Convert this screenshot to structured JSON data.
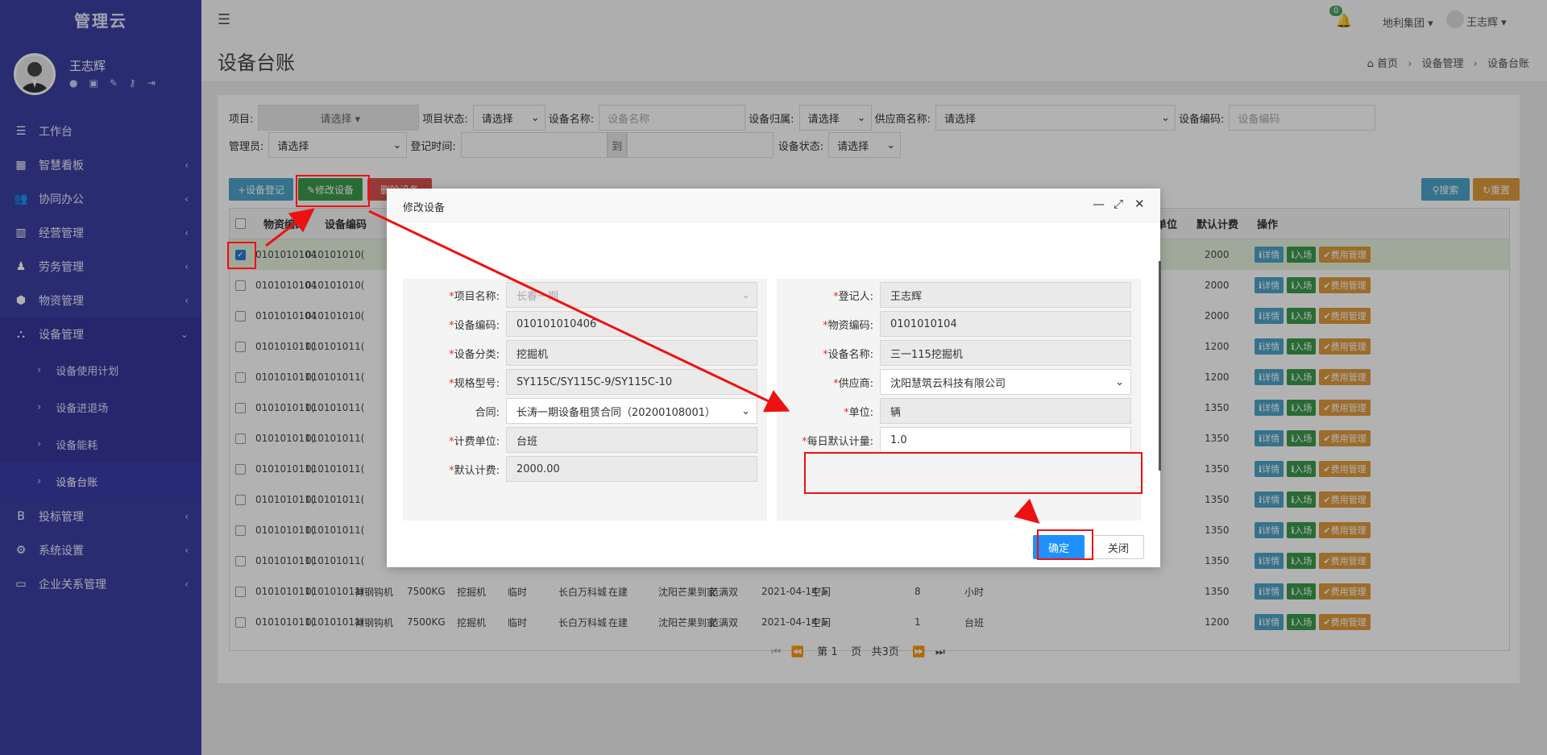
{
  "brand": "管理云",
  "user": {
    "name": "王志辉"
  },
  "sidebar": {
    "items": [
      {
        "label": "工作台",
        "icon": "dashboard-icon",
        "glyph": "☰",
        "chev": ""
      },
      {
        "label": "智慧看板",
        "icon": "board-icon",
        "glyph": "▦",
        "chev": "‹"
      },
      {
        "label": "协同办公",
        "icon": "users-icon",
        "glyph": "👥",
        "chev": "‹"
      },
      {
        "label": "经营管理",
        "icon": "bar-chart-icon",
        "glyph": "▥",
        "chev": "‹"
      },
      {
        "label": "劳务管理",
        "icon": "worker-icon",
        "glyph": "♟",
        "chev": "‹"
      },
      {
        "label": "物资管理",
        "icon": "cube-icon",
        "glyph": "⬢",
        "chev": "‹"
      },
      {
        "label": "设备管理",
        "icon": "cubes-icon",
        "glyph": "⛬",
        "chev": "⌄"
      }
    ],
    "sub_items": [
      "设备使用计划",
      "设备进退场",
      "设备能耗",
      "设备台账"
    ],
    "items_after": [
      {
        "label": "投标管理",
        "icon": "bold-b-icon",
        "glyph": "B",
        "chev": "‹"
      },
      {
        "label": "系统设置",
        "icon": "gear-icon",
        "glyph": "⚙",
        "chev": "‹"
      },
      {
        "label": "企业关系管理",
        "icon": "monitor-icon",
        "glyph": "▭",
        "chev": "‹"
      }
    ]
  },
  "topbar": {
    "notifications": "0",
    "company": "地利集团 ▾",
    "user": "王志辉 ▾"
  },
  "page": {
    "title": "设备台账",
    "breadcrumb": [
      "首页",
      "设备管理",
      "设备台账"
    ]
  },
  "filters": {
    "project_label": "项目:",
    "project_value": "请选择 ▾",
    "project_status_label": "项目状态:",
    "project_status_value": "请选择",
    "device_name_label": "设备名称:",
    "device_name_placeholder": "设备名称",
    "ownership_label": "设备归属:",
    "ownership_value": "请选择",
    "supplier_label": "供应商名称:",
    "supplier_value": "请选择",
    "device_code_label": "设备编码:",
    "device_code_placeholder": "设备编码",
    "manager_label": "管理员:",
    "manager_value": "请选择",
    "reg_time_label": "登记时间:",
    "reg_time_to": "到",
    "device_status_label": "设备状态:",
    "device_status_value": "请选择"
  },
  "toolbar": {
    "register": "+设备登记",
    "edit": "✎修改设备",
    "delete": "删除设备",
    "search": "⚲搜索",
    "reset": "↻重置"
  },
  "table": {
    "headers": [
      "物资编码",
      "设备编码",
      "单位",
      "默认计费",
      "操作"
    ],
    "rows": [
      {
        "c1": "0101010104",
        "c2": "010101010(",
        "fee": "2000",
        "extra": []
      },
      {
        "c1": "0101010104",
        "c2": "010101010(",
        "fee": "2000",
        "extra": []
      },
      {
        "c1": "0101010104",
        "c2": "010101010(",
        "fee": "2000",
        "extra": []
      },
      {
        "c1": "010101011(",
        "c2": "010101011(",
        "fee": "1200",
        "extra": []
      },
      {
        "c1": "010101011(",
        "c2": "010101011(",
        "fee": "1200",
        "extra": []
      },
      {
        "c1": "010101011(",
        "c2": "010101011(",
        "fee": "1350",
        "extra": []
      },
      {
        "c1": "010101011(",
        "c2": "010101011(",
        "fee": "1350",
        "extra": []
      },
      {
        "c1": "010101011(",
        "c2": "010101011(",
        "fee": "1350",
        "extra": []
      },
      {
        "c1": "010101011(",
        "c2": "010101011(",
        "fee": "1350",
        "extra": []
      },
      {
        "c1": "010101011(",
        "c2": "010101011(",
        "fee": "1350",
        "extra": []
      },
      {
        "c1": "010101011(",
        "c2": "010101011(",
        "fee": "1350",
        "extra": []
      },
      {
        "c1": "010101011(",
        "c2": "010101011(",
        "fee": "1350",
        "extra": [
          "神钢钩机",
          "7500KG",
          "挖掘机",
          "临时",
          "长白万科城",
          "在建",
          "沈阳芒果到家",
          "范满双",
          "2021-04-14 1",
          "空闲",
          "8",
          "小时"
        ]
      },
      {
        "c1": "010101011(",
        "c2": "010101011(",
        "fee": "1200",
        "extra": [
          "神钢钩机",
          "7500KG",
          "挖掘机",
          "临时",
          "长白万科城",
          "在建",
          "沈阳芒果到家",
          "范满双",
          "2021-04-14 1",
          "空闲",
          "1",
          "台班"
        ]
      }
    ],
    "ops": [
      "ℹ详情",
      "ℹ入场",
      "✔费用管理"
    ]
  },
  "pager": {
    "page_prefix": "第",
    "page_num": "1",
    "page_suffix": "页",
    "total": "共3页"
  },
  "modal": {
    "title": "修改设备",
    "left": [
      {
        "label": "项目名称:",
        "value": "长春一期",
        "req": "*",
        "select": true,
        "muted": true
      },
      {
        "label": "设备编码:",
        "value": "010101010406",
        "req": "*"
      },
      {
        "label": "设备分类:",
        "value": "挖掘机",
        "req": "*"
      },
      {
        "label": "规格型号:",
        "value": "SY115C/SY115C-9/SY115C-10",
        "req": "*"
      },
      {
        "label": "合同:",
        "value": "长涛一期设备租赁合同（20200108001）",
        "req": "",
        "select": true,
        "white": true
      },
      {
        "label": "计费单位:",
        "value": "台班",
        "req": "*"
      },
      {
        "label": "默认计费:",
        "value": "2000.00",
        "req": "*"
      }
    ],
    "right": [
      {
        "label": "登记人:",
        "value": "王志辉",
        "req": "*"
      },
      {
        "label": "物资编码:",
        "value": "0101010104",
        "req": "*"
      },
      {
        "label": "设备名称:",
        "value": "三一115挖掘机",
        "req": "*"
      },
      {
        "label": "供应商:",
        "value": "沈阳慧筑云科技有限公司",
        "req": "*",
        "select": true,
        "white": true
      },
      {
        "label": "单位:",
        "value": "辆",
        "req": "*"
      },
      {
        "label": "每日默认计量:",
        "value": "1.0",
        "req": "*",
        "white": true
      }
    ],
    "confirm": "确定",
    "close": "关闭"
  },
  "colors": {
    "sidebar": "#3d40a3",
    "annotation": "#e11111",
    "confirm": "#1e90ff"
  }
}
